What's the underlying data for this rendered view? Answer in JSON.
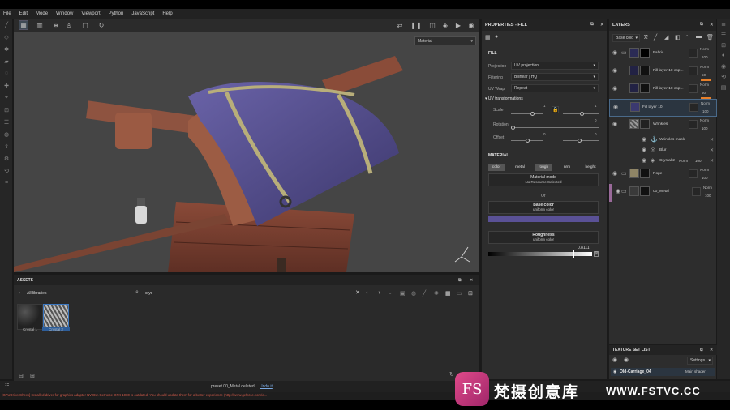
{
  "menu": [
    "File",
    "Edit",
    "Mode",
    "Window",
    "Viewport",
    "Python",
    "JavaScript",
    "Help"
  ],
  "viewport": {
    "material_select": "Material",
    "icons": [
      "grid-icon",
      "layout-icon",
      "symmetry-icon",
      "person-icon",
      "frame-icon",
      "refresh-icon",
      "resolution-icon",
      "pause-icon",
      "camera-icon",
      "cube-icon",
      "video-icon",
      "display-icon",
      "screenshot-icon"
    ]
  },
  "assets": {
    "title": "ASSETS",
    "library": "All libraries",
    "search_value": "crys",
    "items": [
      {
        "label": "Crystal 1"
      },
      {
        "label": "Crystal 2"
      }
    ]
  },
  "properties": {
    "title": "PROPERTIES - FILL",
    "fill_header": "FILL",
    "projection_label": "Projection",
    "projection_value": "UV projection",
    "filtering_label": "Filtering",
    "filtering_value": "Bilinear | HQ",
    "uvwrap_label": "UV Wrap",
    "uvwrap_value": "Repeat",
    "uv_transform_header": "UV transformations",
    "scale_label": "Scale",
    "scale_value": "1",
    "scale_value2": "1",
    "rotation_label": "Rotation",
    "rotation_value": "0",
    "offset_label": "Offset",
    "offset_value": "0",
    "offset_value2": "0",
    "material_header": "MATERIAL",
    "channels": [
      "color",
      "metal",
      "rough",
      "nrm",
      "height"
    ],
    "material_mode_title": "Material mode",
    "material_mode_sub": "No Resource Selected",
    "or_text": "Or",
    "base_color_title": "Base color",
    "base_color_sub": "uniform color",
    "base_color_hex": "#5a5196",
    "roughness_title": "Roughness",
    "roughness_sub": "uniform color",
    "roughness_value": "0.8111",
    "roughness_fraction": 0.8111
  },
  "layers": {
    "title": "LAYERS",
    "channel_select": "Base colo",
    "items": [
      {
        "name": "Fabric",
        "mode": "Norm",
        "opacity": "100",
        "thumb": "#2b2b55",
        "type": "folder"
      },
      {
        "name": "Fill layer 10 cop...",
        "mode": "Norm",
        "opacity": "50",
        "thumb": "#222244",
        "type": "fill"
      },
      {
        "name": "Fill layer 10 cop...",
        "mode": "Norm",
        "opacity": "50",
        "thumb": "#222244",
        "type": "fill"
      },
      {
        "name": "Fill layer 10",
        "mode": "Norm",
        "opacity": "100",
        "thumb": "#3b3970",
        "type": "fill"
      },
      {
        "name": "Wrinkles",
        "mode": "Norm",
        "opacity": "100",
        "thumb": "#777",
        "type": "fill"
      }
    ],
    "effects": [
      {
        "name": "Wrinkles mask"
      },
      {
        "name": "Blur"
      },
      {
        "name": "Crystal 2",
        "mode": "Norm",
        "opacity": "100"
      }
    ],
    "folders": [
      {
        "name": "Rope",
        "mode": "Norm",
        "opacity": "100",
        "thumb": "#8f8566"
      },
      {
        "name": "00_Metal",
        "mode": "Norm",
        "opacity": "100",
        "thumb": "#3a3a3a"
      }
    ]
  },
  "texture_set": {
    "title": "TEXTURE SET LIST",
    "settings": "Settings",
    "set_name": "Old-Carriage_04",
    "shader": "Main shader"
  },
  "status": {
    "message": "preset 00_Metal deleted.",
    "undo": "Undo it",
    "console": "[GPUDriverCheck] Installed driver for graphics adapter NVIDIA GeForce GTX 1080 is outdated. You should update them for a better experience (http://www.geforce.com/d..."
  },
  "watermark": {
    "brand_short": "FS",
    "brand_cn": "梵摄创意库",
    "url": "WWW.FSTVC.CC"
  }
}
